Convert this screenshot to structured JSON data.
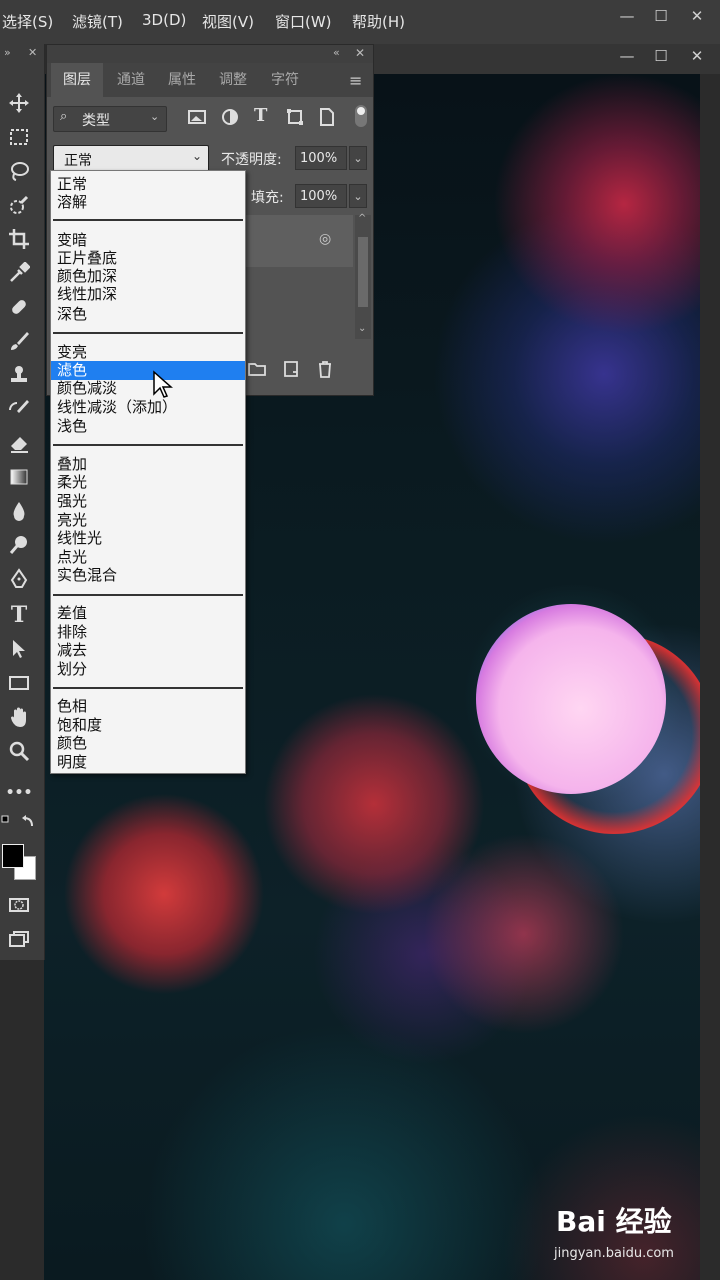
{
  "menubar": {
    "items": [
      "选择(S)",
      "滤镜(T)",
      "3D(D)",
      "视图(V)",
      "窗口(W)",
      "帮助(H)"
    ],
    "window_controls": [
      "—",
      "☐",
      "✕"
    ],
    "doc_controls": [
      "—",
      "☐",
      "✕"
    ]
  },
  "panel": {
    "tabs": [
      "图层",
      "通道",
      "属性",
      "调整",
      "字符"
    ],
    "active_tab": "图层",
    "filter_label": "类型",
    "blend_mode": "正常",
    "opacity_label": "不透明度:",
    "opacity_value": "100%",
    "fill_label": "填充:",
    "fill_value": "100%"
  },
  "blend_modes": {
    "groups": [
      [
        "正常",
        "溶解"
      ],
      [
        "变暗",
        "正片叠底",
        "颜色加深",
        "线性加深",
        "深色"
      ],
      [
        "变亮",
        "滤色",
        "颜色减淡",
        "线性减淡（添加）",
        "浅色"
      ],
      [
        "叠加",
        "柔光",
        "强光",
        "亮光",
        "线性光",
        "点光",
        "实色混合"
      ],
      [
        "差值",
        "排除",
        "减去",
        "划分"
      ],
      [
        "色相",
        "饱和度",
        "颜色",
        "明度"
      ]
    ],
    "highlighted": "滤色"
  },
  "toolbar": {
    "tools": [
      "move-icon",
      "marquee-icon",
      "lasso-icon",
      "quick-select-icon",
      "crop-icon",
      "eyedropper-icon",
      "healing-icon",
      "brush-icon",
      "stamp-icon",
      "history-brush-icon",
      "eraser-icon",
      "gradient-icon",
      "blur-icon",
      "dodge-icon",
      "pen-icon",
      "type-icon",
      "path-select-icon",
      "rectangle-icon",
      "hand-icon",
      "zoom-icon",
      "more-icon"
    ],
    "more_label": "•••",
    "type_label": "T",
    "foreground_color": "#000000",
    "background_color": "#ffffff"
  },
  "watermark": {
    "logo": "Bai 经验",
    "url": "jingyan.baidu.com"
  }
}
